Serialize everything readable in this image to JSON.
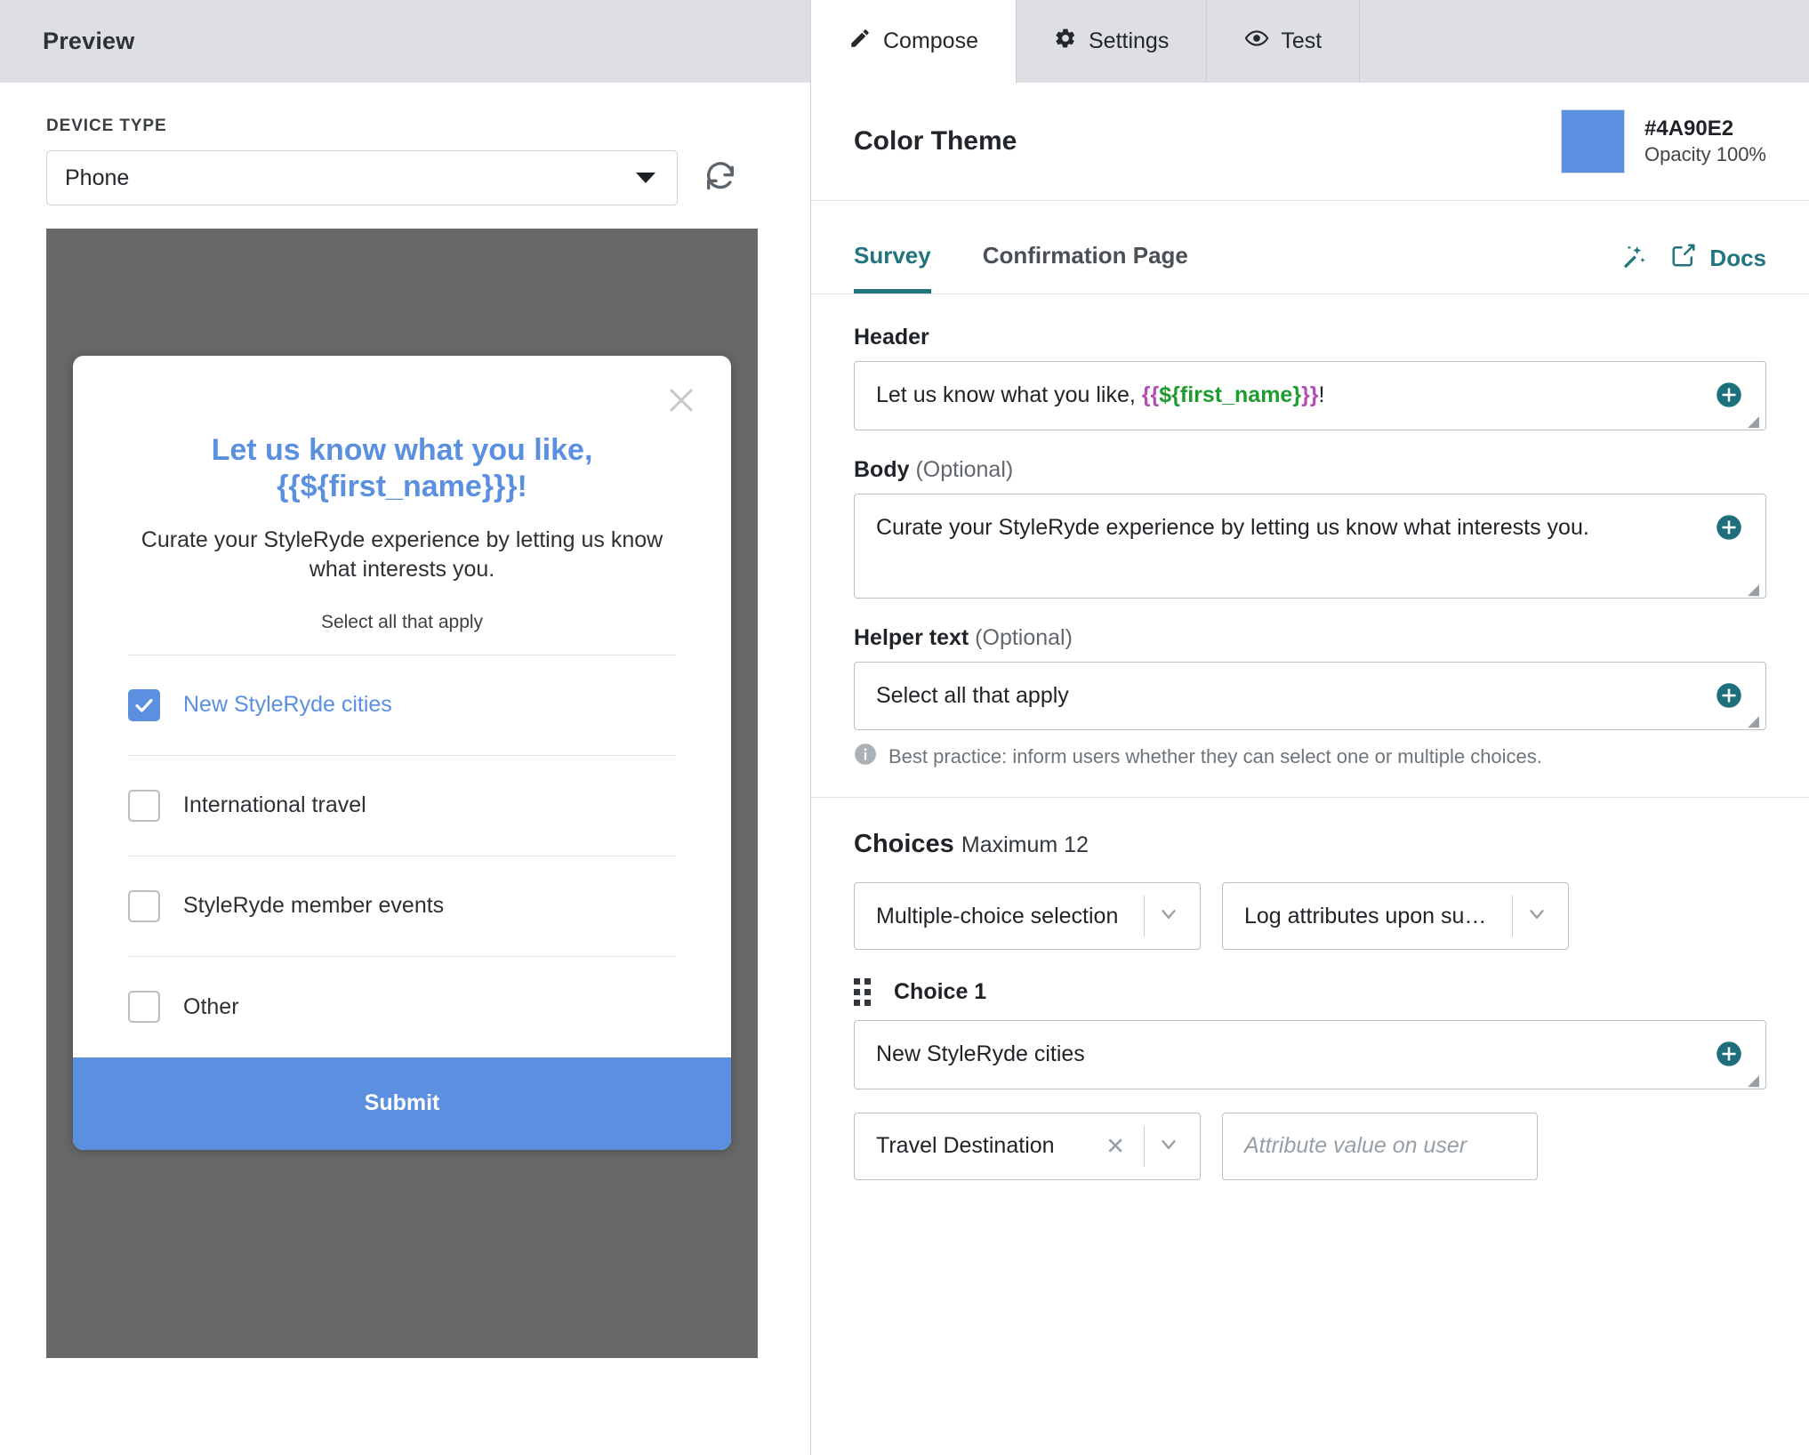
{
  "preview": {
    "title": "Preview",
    "device_label": "DEVICE TYPE",
    "device_value": "Phone",
    "refresh_icon": "refresh-icon",
    "modal": {
      "close_icon": "close-icon",
      "header": "Let us know what you like, {{${first_name}}}!",
      "body": "Curate your StyleRyde experience by letting us know what interests you.",
      "helper": "Select all that apply",
      "choices": [
        {
          "label": "New StyleRyde cities",
          "checked": true
        },
        {
          "label": "International travel",
          "checked": false
        },
        {
          "label": "StyleRyde member events",
          "checked": false
        },
        {
          "label": "Other",
          "checked": false
        }
      ],
      "submit_label": "Submit"
    }
  },
  "editor": {
    "tabs": [
      {
        "label": "Compose",
        "icon": "pencil-icon",
        "active": true
      },
      {
        "label": "Settings",
        "icon": "gear-icon",
        "active": false
      },
      {
        "label": "Test",
        "icon": "eye-icon",
        "active": false
      }
    ],
    "color_theme": {
      "title": "Color Theme",
      "hex": "#4A90E2",
      "opacity": "Opacity 100%",
      "swatch_color": "#5b8fe0"
    },
    "subtabs": [
      {
        "label": "Survey",
        "active": true
      },
      {
        "label": "Confirmation Page",
        "active": false
      }
    ],
    "magic_icon": "magic-wand-icon",
    "docs_label": "Docs",
    "docs_icon": "external-link-icon",
    "fields": {
      "header": {
        "label": "Header",
        "optional": "",
        "text_before": "Let us know what you like, ",
        "brace_open": "{{",
        "variable": "${first_name}",
        "brace_close": "}}",
        "text_after": "!",
        "add_icon": "add-personalization-icon"
      },
      "body": {
        "label": "Body",
        "optional": "(Optional)",
        "value": "Curate your StyleRyde experience by letting us know what interests you.",
        "add_icon": "add-personalization-icon"
      },
      "helper": {
        "label": "Helper text",
        "optional": "(Optional)",
        "value": "Select all that apply",
        "add_icon": "add-personalization-icon",
        "hint": "Best practice: inform users whether they can select one or multiple choices.",
        "hint_icon": "info-icon"
      }
    },
    "choices": {
      "title": "Choices",
      "max": "Maximum 12",
      "selection_type": "Multiple-choice selection",
      "log_behavior": "Log attributes upon subm...",
      "items": [
        {
          "name": "Choice 1",
          "value": "New StyleRyde cities",
          "attribute": "Travel Destination",
          "attribute_value_placeholder": "Attribute value on user",
          "drag_icon": "drag-handle-icon",
          "clear_icon": "clear-icon",
          "add_icon": "add-personalization-icon"
        }
      ]
    }
  }
}
